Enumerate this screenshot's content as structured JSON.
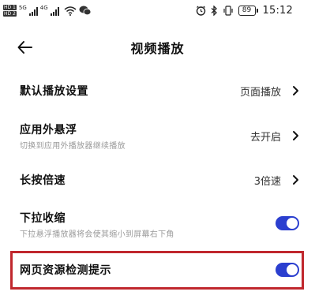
{
  "status_bar": {
    "sim1": "HD 1",
    "sim2": "HD 2",
    "net1": "5G",
    "net2": "4G",
    "battery": "89",
    "time": "15:12",
    "icons": [
      "wifi-icon",
      "wechat-icon",
      "alarm-icon",
      "bluetooth-icon",
      "vibrate-icon"
    ]
  },
  "header": {
    "back_icon": "arrow-left-icon",
    "title": "视频播放"
  },
  "settings": {
    "default_play": {
      "title": "默认播放设置",
      "value": "页面播放"
    },
    "floating": {
      "title": "应用外悬浮",
      "subtitle": "切换到应用外播放器继续播放",
      "value": "去开启"
    },
    "long_press": {
      "title": "长按倍速",
      "value": "3倍速"
    },
    "pull_down": {
      "title": "下拉收缩",
      "subtitle": "下拉悬浮播放器将会使其缩小到屏幕右下角",
      "enabled": true
    },
    "resource_detect": {
      "title": "网页资源检测提示",
      "enabled": true
    }
  },
  "colors": {
    "toggle_on": "#2b3fcf",
    "highlight": "#c0272d",
    "subtitle": "#9a9a9a"
  }
}
